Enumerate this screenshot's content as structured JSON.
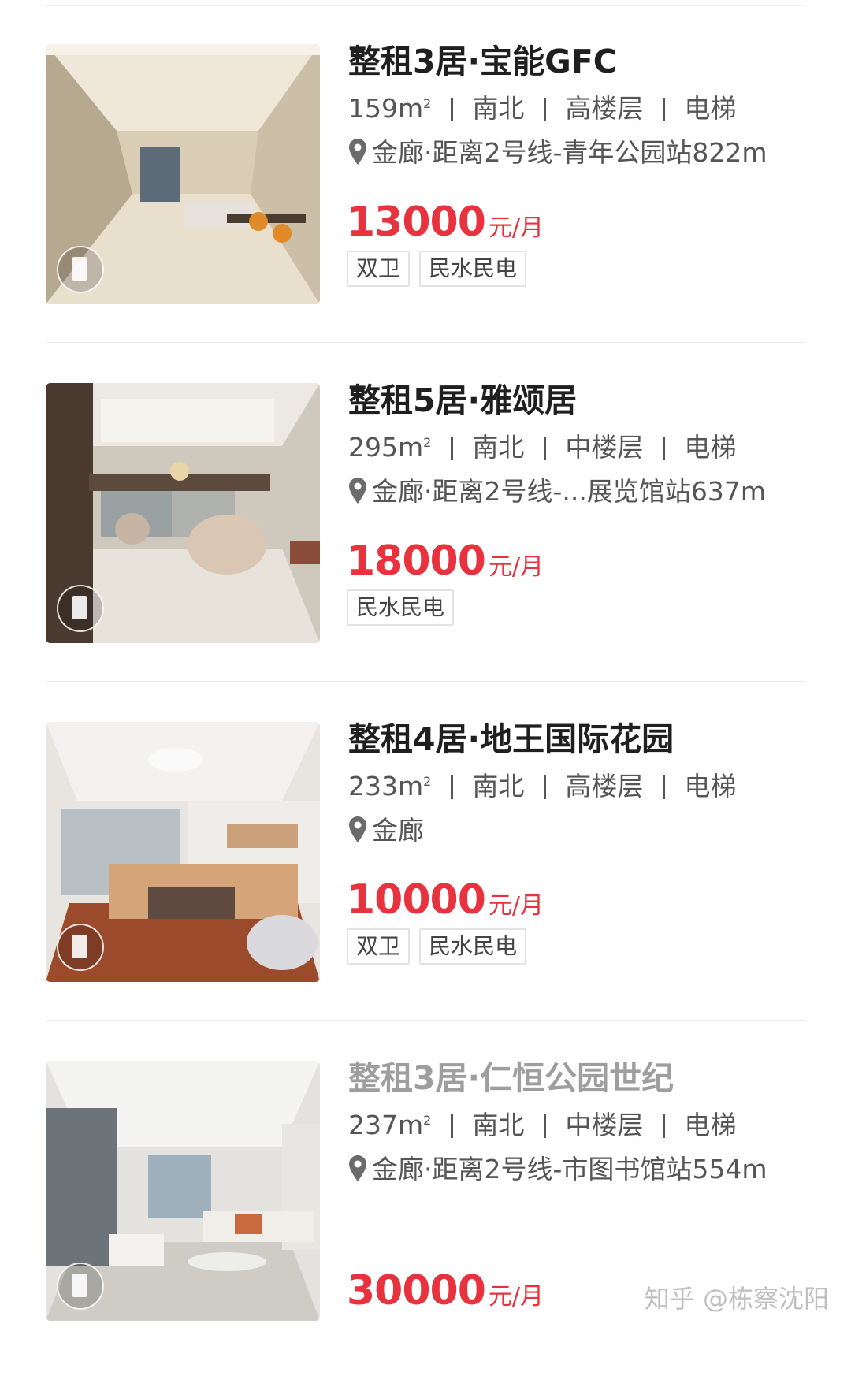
{
  "listings": [
    {
      "title": "整租3居·宝能GFC",
      "area": "159m",
      "area_sup": "2",
      "orientation": "南北",
      "floor": "高楼层",
      "elevator": "电梯",
      "location": "金廊·距离2号线-青年公园站822m",
      "price": "13000",
      "price_unit": "元/月",
      "tags": [
        "双卫",
        "民水民电"
      ]
    },
    {
      "title": "整租5居·雅颂居",
      "area": "295m",
      "area_sup": "2",
      "orientation": "南北",
      "floor": "中楼层",
      "elevator": "电梯",
      "location": "金廊·距离2号线-...展览馆站637m",
      "price": "18000",
      "price_unit": "元/月",
      "tags": [
        "民水民电"
      ]
    },
    {
      "title": "整租4居·地王国际花园",
      "area": "233m",
      "area_sup": "2",
      "orientation": "南北",
      "floor": "高楼层",
      "elevator": "电梯",
      "location": "金廊",
      "price": "10000",
      "price_unit": "元/月",
      "tags": [
        "双卫",
        "民水民电"
      ]
    },
    {
      "title": "整租3居·仁恒公园世纪",
      "area": "237m",
      "area_sup": "2",
      "orientation": "南北",
      "floor": "中楼层",
      "elevator": "电梯",
      "location": "金廊·距离2号线-市图书馆站554m",
      "price": "30000",
      "price_unit": "元/月",
      "tags": []
    }
  ],
  "watermark": "知乎 @栋察沈阳",
  "colors": {
    "price": "#e8323e",
    "title": "#1f1f1f",
    "meta": "#555555"
  },
  "icons": {
    "location": "location-pin-icon",
    "vr": "vr-view-icon"
  }
}
